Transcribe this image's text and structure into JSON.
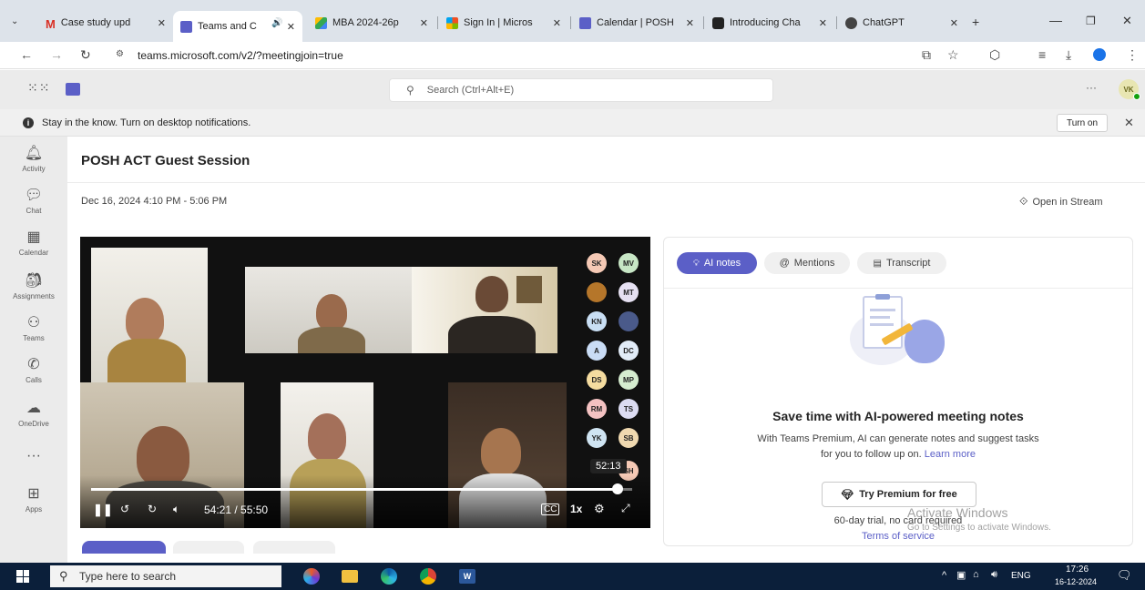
{
  "browser": {
    "tabs": [
      {
        "label": "Case study upd",
        "color": "#d93025",
        "glyph": "M"
      },
      {
        "label": "Teams and C",
        "color": "#5b5fc7",
        "glyph": ""
      },
      {
        "label": "MBA 2024-26p",
        "color": "#34a853",
        "glyph": ""
      },
      {
        "label": "Sign In | Micros",
        "color": "#f25022",
        "glyph": ""
      },
      {
        "label": "Calendar | POSH",
        "color": "#5b5fc7",
        "glyph": ""
      },
      {
        "label": "Introducing Cha",
        "color": "#222222",
        "glyph": ""
      },
      {
        "label": "ChatGPT",
        "color": "#444444",
        "glyph": ""
      }
    ],
    "active_tab": 1,
    "url": "teams.microsoft.com/v2/?meetingjoin=true"
  },
  "teams": {
    "search_placeholder": "Search (Ctrl+Alt+E)",
    "more": "···",
    "user_initials": "VK",
    "notification": "Stay in the know. Turn on desktop notifications.",
    "turn_on": "Turn on",
    "rail": [
      {
        "label": "Activity",
        "glyph": "🔔"
      },
      {
        "label": "Chat",
        "glyph": "💬"
      },
      {
        "label": "Calendar",
        "glyph": "▦"
      },
      {
        "label": "Assignments",
        "glyph": "🔒"
      },
      {
        "label": "Teams",
        "glyph": "⚇"
      },
      {
        "label": "Calls",
        "glyph": "✆"
      },
      {
        "label": "OneDrive",
        "glyph": "☁"
      },
      {
        "label": "",
        "glyph": "···"
      },
      {
        "label": "Apps",
        "glyph": "⊞"
      }
    ]
  },
  "meeting": {
    "title": "POSH ACT Guest Session",
    "datetime": "Dec 16, 2024 4:10 PM - 5:06 PM",
    "open_in_stream": "Open in Stream",
    "player": {
      "time": "54:21 / 55:50",
      "speed": "1x",
      "tooltip_time": "52:13",
      "progress": 0.973
    },
    "avatars": [
      "SK",
      "MV",
      "",
      "MT",
      "KN",
      "",
      "A",
      "DC",
      "DS",
      "MP",
      "RM",
      "TS",
      "YK",
      "SB",
      "",
      "SH"
    ]
  },
  "ai_panel": {
    "tabs": [
      "AI notes",
      "Mentions",
      "Transcript"
    ],
    "heading": "Save time with AI-powered meeting notes",
    "body_line1": "With Teams Premium, AI can generate notes and suggest tasks",
    "body_line2": "for you to follow up on.",
    "learn_more": "Learn more",
    "cta": "Try Premium for free",
    "trial": "60-day trial, no card required",
    "terms": "Terms of service",
    "watermark1": "Activate Windows",
    "watermark2": "Go to Settings to activate Windows."
  },
  "taskbar": {
    "search": "Type here to search",
    "lang": "ENG",
    "time": "17:26",
    "date": "16-12-2024"
  }
}
